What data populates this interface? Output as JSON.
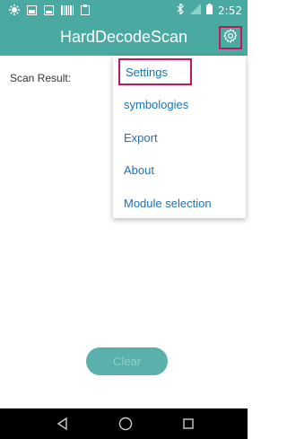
{
  "statusbar": {
    "time": "2:52",
    "icons_left": [
      "gear-icon",
      "image-icon",
      "image-icon",
      "barcode-icon",
      "clipboard-icon"
    ],
    "icons_right": [
      "bluetooth-icon",
      "signal-icon",
      "battery-icon"
    ]
  },
  "appbar": {
    "title": "HardDecodeScan",
    "settings_icon": "gear-icon"
  },
  "content": {
    "scan_result_label": "Scan Result:"
  },
  "menu": {
    "items": [
      {
        "label": "Settings"
      },
      {
        "label": "symbologies"
      },
      {
        "label": "Export"
      },
      {
        "label": "About"
      },
      {
        "label": "Module selection"
      }
    ]
  },
  "clear_button": {
    "label": "Clear"
  },
  "navbar": {
    "icons": [
      "back-icon",
      "home-icon",
      "recents-icon"
    ]
  },
  "colors": {
    "primary": "#4aa9a1",
    "highlight": "#c2185b",
    "menu_text": "#1a73b5",
    "button": "#5ab0aa"
  }
}
